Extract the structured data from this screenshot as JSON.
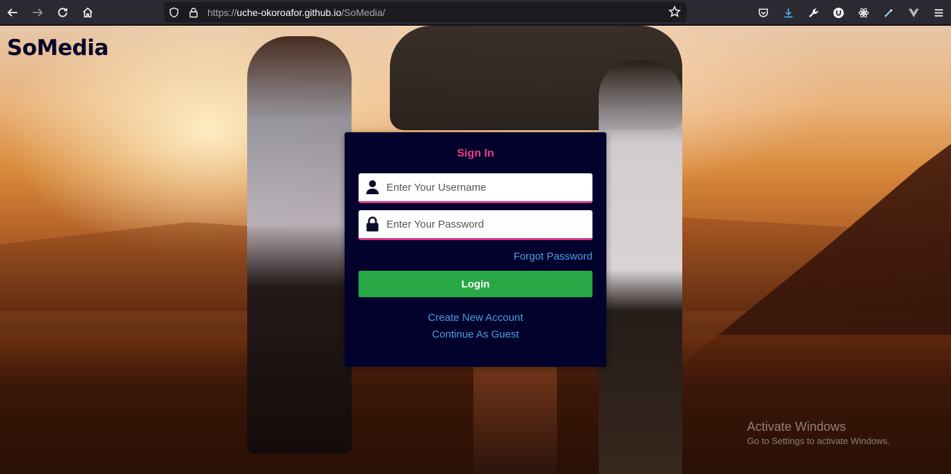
{
  "browser": {
    "url_prefix": "https://",
    "url_host": "uche-okoroafor.github.io",
    "url_path": "/SoMedia/"
  },
  "page": {
    "brand": "SoMedia"
  },
  "login_card": {
    "title": "Sign In",
    "username_placeholder": "Enter Your Username",
    "password_placeholder": "Enter Your Password",
    "forgot_label": "Forgot Password",
    "login_label": "Login",
    "create_label": "Create New Account",
    "guest_label": "Continue As Guest"
  },
  "os_watermark": {
    "line1": "Activate Windows",
    "line2": "Go to Settings to activate Windows."
  },
  "colors": {
    "card_bg": "#02022c",
    "accent_pink": "#ed3d87",
    "login_green": "#28a745",
    "link_blue": "#4a9fe0"
  }
}
